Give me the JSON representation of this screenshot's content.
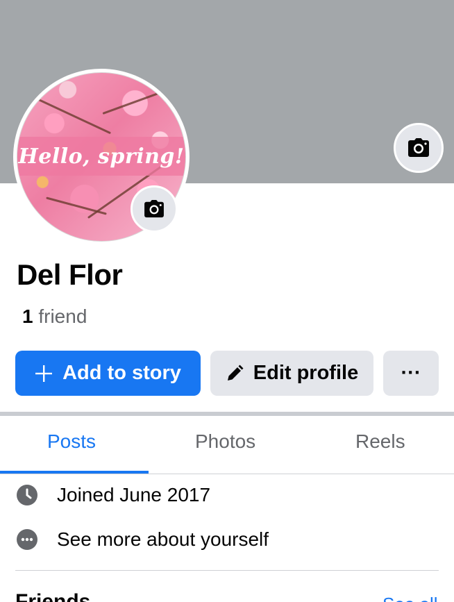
{
  "profile": {
    "name": "Del Flor",
    "friend_count": "1",
    "friend_label": "friend",
    "avatar_text": "Hello, spring!"
  },
  "actions": {
    "add_story_label": "Add to story",
    "edit_profile_label": "Edit profile",
    "more_label": "···"
  },
  "tabs": [
    {
      "label": "Posts",
      "active": true
    },
    {
      "label": "Photos",
      "active": false
    },
    {
      "label": "Reels",
      "active": false
    }
  ],
  "details": {
    "joined": "Joined June 2017",
    "see_more": "See more about yourself"
  },
  "friends_section": {
    "heading": "Friends",
    "see_all": "See all"
  },
  "colors": {
    "accent": "#1877f2",
    "cover": "#a3a7aa",
    "button_secondary": "#e4e6eb"
  },
  "icons": {
    "cover_camera": "camera-icon",
    "avatar_camera": "camera-icon",
    "add": "plus-icon",
    "edit": "pencil-icon",
    "joined": "clock-icon",
    "more_info": "more-dots-icon"
  }
}
